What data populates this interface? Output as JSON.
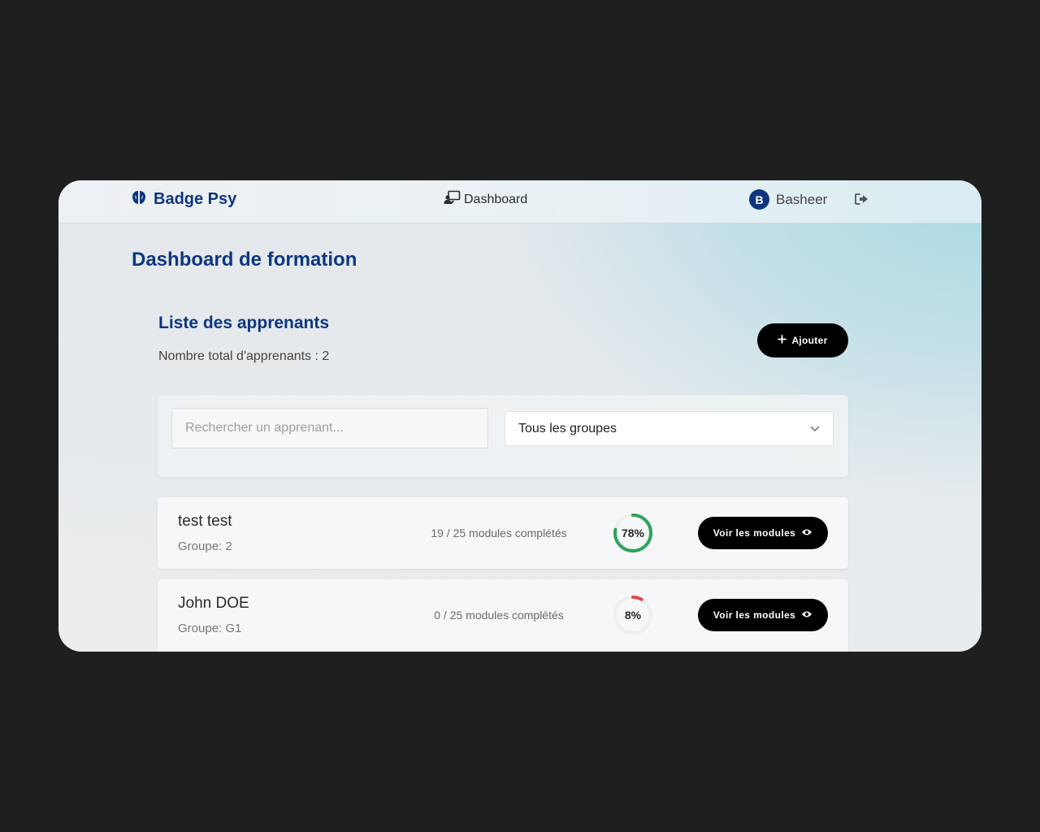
{
  "brand": {
    "name": "Badge Psy",
    "icon": "brain-icon",
    "color": "#0d3680"
  },
  "nav": {
    "dashboard_label": "Dashboard",
    "dashboard_icon": "presentation-icon",
    "user_initial": "B",
    "user_name": "Basheer",
    "logout_icon": "logout-icon"
  },
  "page": {
    "title": "Dashboard de formation"
  },
  "learners_section": {
    "title": "Liste des apprenants",
    "total_label": "Nombre total d'apprenants : 2",
    "add_button_label": "Ajouter",
    "add_icon": "plus-icon"
  },
  "filters": {
    "search_placeholder": "Rechercher un apprenant...",
    "search_value": "",
    "group_select_value": "Tous les groupes",
    "group_select_icon": "chevron-down-icon"
  },
  "learners": [
    {
      "name": "test test",
      "group": "Groupe: 2",
      "modules": "19 / 25 modules complétés",
      "progress_label": "78%",
      "progress": 0.78,
      "progress_color": "#2ca55a",
      "button_label": "Voir les modules",
      "button_icon": "eye-icon"
    },
    {
      "name": "John DOE",
      "group": "Groupe: G1",
      "modules": "0 / 25 modules complétés",
      "progress_label": "8%",
      "progress": 0.08,
      "progress_color": "#e04848",
      "button_label": "Voir les modules",
      "button_icon": "eye-icon"
    }
  ],
  "colors": {
    "accent": "#0d3680",
    "button_bg": "#000000",
    "app_background": "#1f1f1f"
  }
}
